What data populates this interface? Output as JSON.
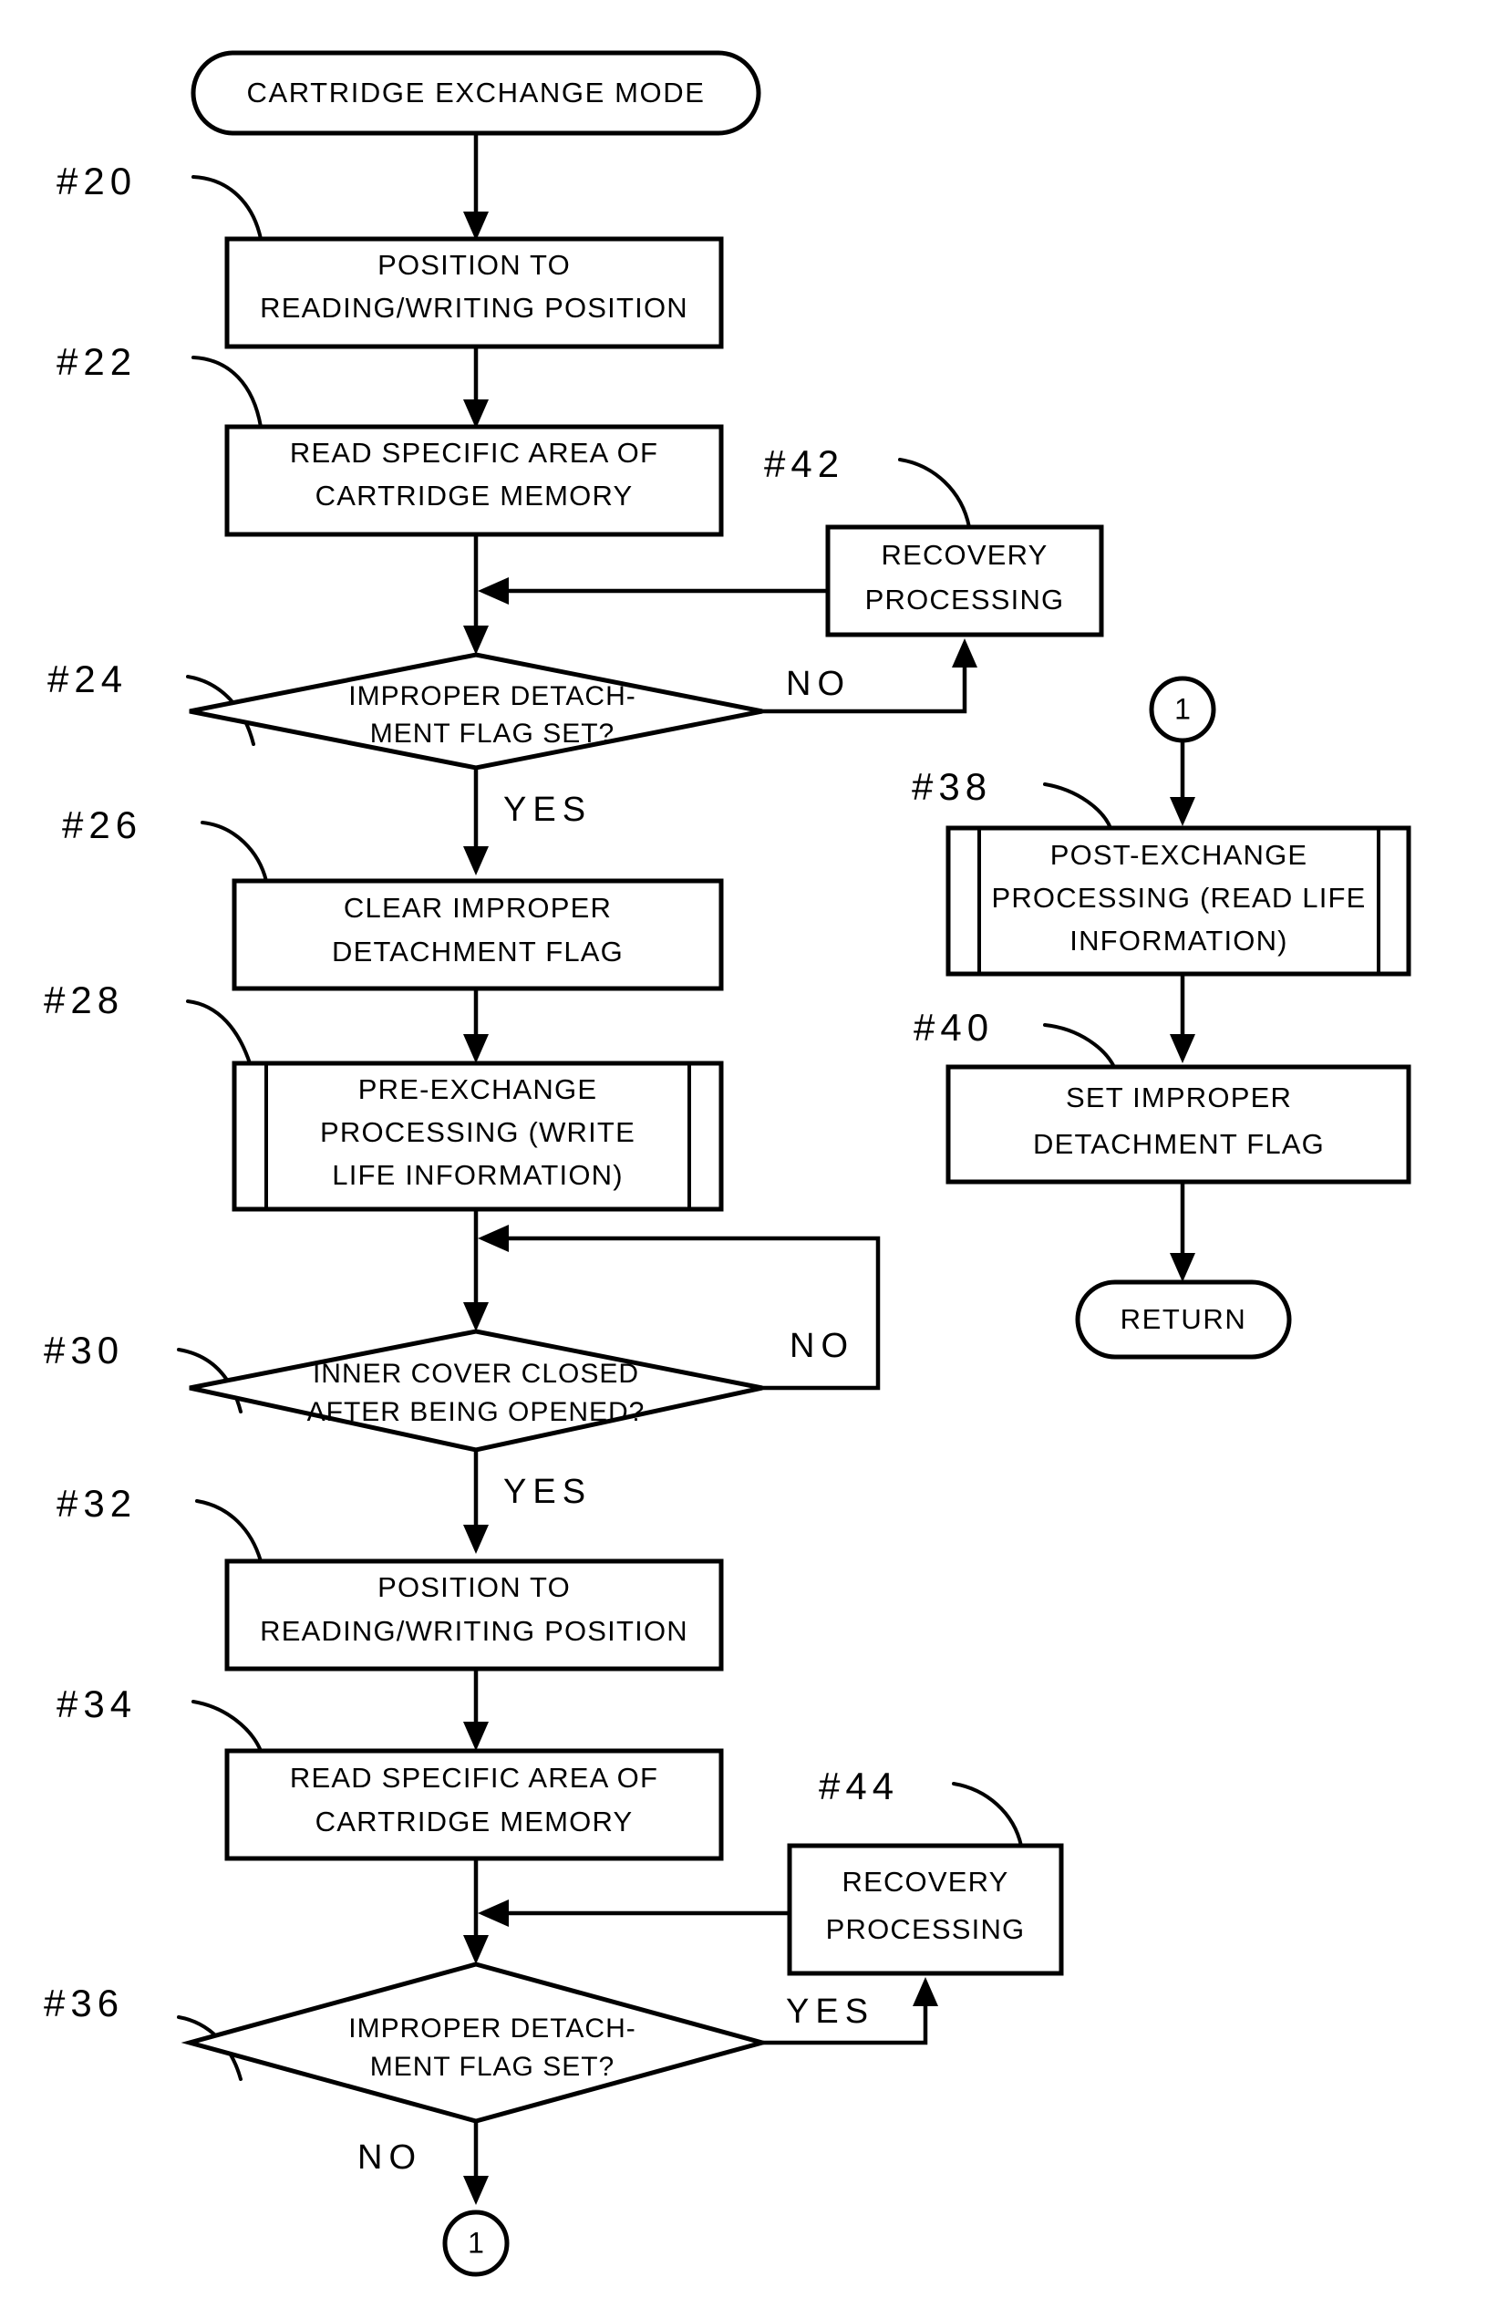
{
  "diagram": {
    "type": "flowchart",
    "title": "CARTRIDGE EXCHANGE MODE",
    "terminals": [
      {
        "id": "start",
        "label": "CARTRIDGE EXCHANGE MODE"
      },
      {
        "id": "return",
        "label": "RETURN"
      }
    ],
    "process_boxes": [
      {
        "ref": "#20",
        "line1": "POSITION TO",
        "line2": "READING/WRITING POSITION",
        "line3": ""
      },
      {
        "ref": "#22",
        "line1": "READ SPECIFIC AREA OF",
        "line2": "CARTRIDGE MEMORY",
        "line3": ""
      },
      {
        "ref": "#26",
        "line1": "CLEAR IMPROPER",
        "line2": "DETACHMENT FLAG",
        "line3": ""
      },
      {
        "ref": "#28",
        "line1": "PRE-EXCHANGE",
        "line2": "PROCESSING (WRITE",
        "line3": "LIFE INFORMATION)"
      },
      {
        "ref": "#32",
        "line1": "POSITION TO",
        "line2": "READING/WRITING POSITION",
        "line3": ""
      },
      {
        "ref": "#34",
        "line1": "READ SPECIFIC AREA OF",
        "line2": "CARTRIDGE MEMORY",
        "line3": ""
      },
      {
        "ref": "#38",
        "line1": "POST-EXCHANGE",
        "line2": "PROCESSING (READ LIFE",
        "line3": "INFORMATION)"
      },
      {
        "ref": "#40",
        "line1": "SET IMPROPER",
        "line2": "DETACHMENT FLAG",
        "line3": ""
      },
      {
        "ref": "#42",
        "line1": "RECOVERY",
        "line2": "PROCESSING",
        "line3": ""
      },
      {
        "ref": "#44",
        "line1": "RECOVERY",
        "line2": "PROCESSING",
        "line3": ""
      }
    ],
    "decisions": [
      {
        "ref": "#24",
        "line1": "IMPROPER DETACH-",
        "line2": "MENT FLAG SET?",
        "yes": "YES",
        "no": "NO"
      },
      {
        "ref": "#30",
        "line1": "INNER COVER CLOSED",
        "line2": "AFTER BEING OPENED?",
        "yes": "YES",
        "no": "NO"
      },
      {
        "ref": "#36",
        "line1": "IMPROPER DETACH-",
        "line2": "MENT FLAG SET?",
        "yes": "YES",
        "no": "NO"
      }
    ],
    "off_page_connectors": [
      {
        "id": "conn-1-top",
        "label": "1"
      },
      {
        "id": "conn-1-bottom",
        "label": "1"
      }
    ],
    "reference_numbers": [
      "#20",
      "#22",
      "#24",
      "#26",
      "#28",
      "#30",
      "#32",
      "#34",
      "#36",
      "#38",
      "#40",
      "#42",
      "#44"
    ],
    "branch_labels": {
      "d24_no": "NO",
      "d24_yes": "YES",
      "d30_no": "NO",
      "d30_yes": "YES",
      "d36_yes": "YES",
      "d36_no": "NO"
    },
    "colors": {
      "stroke": "#000000",
      "fill": "#ffffff",
      "background": "#ffffff"
    }
  }
}
